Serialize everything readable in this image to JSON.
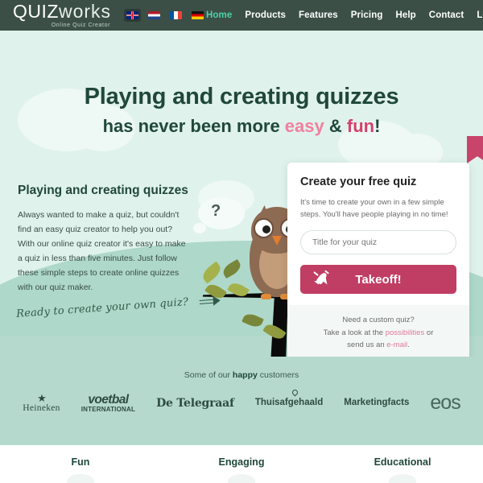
{
  "header": {
    "logo": {
      "main_a": "QUIZ",
      "main_b": "works",
      "tagline": "Online Quiz Creator"
    },
    "languages": [
      {
        "name": "english-flag",
        "label": "EN",
        "active": true
      },
      {
        "name": "dutch-flag",
        "label": "NL",
        "active": false
      },
      {
        "name": "french-flag",
        "label": "FR",
        "active": false
      },
      {
        "name": "german-flag",
        "label": "DE",
        "active": false
      }
    ],
    "nav": [
      {
        "label": "Home",
        "active": true
      },
      {
        "label": "Products",
        "active": false
      },
      {
        "label": "Features",
        "active": false
      },
      {
        "label": "Pricing",
        "active": false
      },
      {
        "label": "Help",
        "active": false
      },
      {
        "label": "Contact",
        "active": false
      },
      {
        "label": "Login",
        "active": false
      }
    ]
  },
  "hero": {
    "title_line1": "Playing and creating quizzes",
    "title_line2_pre": "has never been more ",
    "title_easy": "easy",
    "title_amp": " & ",
    "title_fun": "fun",
    "title_bang": "!",
    "left": {
      "heading": "Playing and creating quizzes",
      "body": "Always wanted to make a quiz, but couldn't find an easy quiz creator to help you out? With our online quiz creator it's easy to make a quiz in less than five minutes. Just follow these simple steps to create online quizzes with our quiz maker.",
      "script_cta": "Ready to create your own quiz?"
    },
    "owl": {
      "thought": "?"
    }
  },
  "signup_card": {
    "heading": "Create your free quiz",
    "description": "It's time to create your own in a few simple steps. You'll have people playing in no time!",
    "input_placeholder": "Title for your quiz",
    "input_value": "",
    "button_label": "Takeoff!",
    "footer_line1": "Need a custom quiz?",
    "footer_line2_pre": "Take a look at the ",
    "footer_link1": "possibilities",
    "footer_line2_post": " or",
    "footer_line3_pre": "send us an ",
    "footer_link2": "e-mail",
    "footer_line3_post": "."
  },
  "customers": {
    "title_pre": "Some of our ",
    "title_bold": "happy",
    "title_post": " customers",
    "logos": [
      {
        "name": "heineken",
        "label": "Heineken",
        "mark": "★"
      },
      {
        "name": "voetbal-international",
        "label": "voetbal",
        "sub": "INTERNATIONAL"
      },
      {
        "name": "de-telegraaf",
        "label": "De Telegraaf"
      },
      {
        "name": "thuisafgehaald",
        "label": "Thuisafgehaald"
      },
      {
        "name": "marketingfacts",
        "label": "Marketingfacts"
      },
      {
        "name": "eos",
        "label": "eos"
      }
    ]
  },
  "features": [
    {
      "name": "fun",
      "label": "Fun"
    },
    {
      "name": "engaging",
      "label": "Engaging"
    },
    {
      "name": "educational",
      "label": "Educational"
    }
  ],
  "colors": {
    "header_bg": "#3b4f47",
    "hero_bg": "#e0f2ec",
    "accent_teal": "#4dd2a8",
    "accent_crimson": "#c03d63",
    "accent_pink": "#f2809f",
    "dark_green": "#20483a",
    "band_bg": "#b5dacd"
  }
}
